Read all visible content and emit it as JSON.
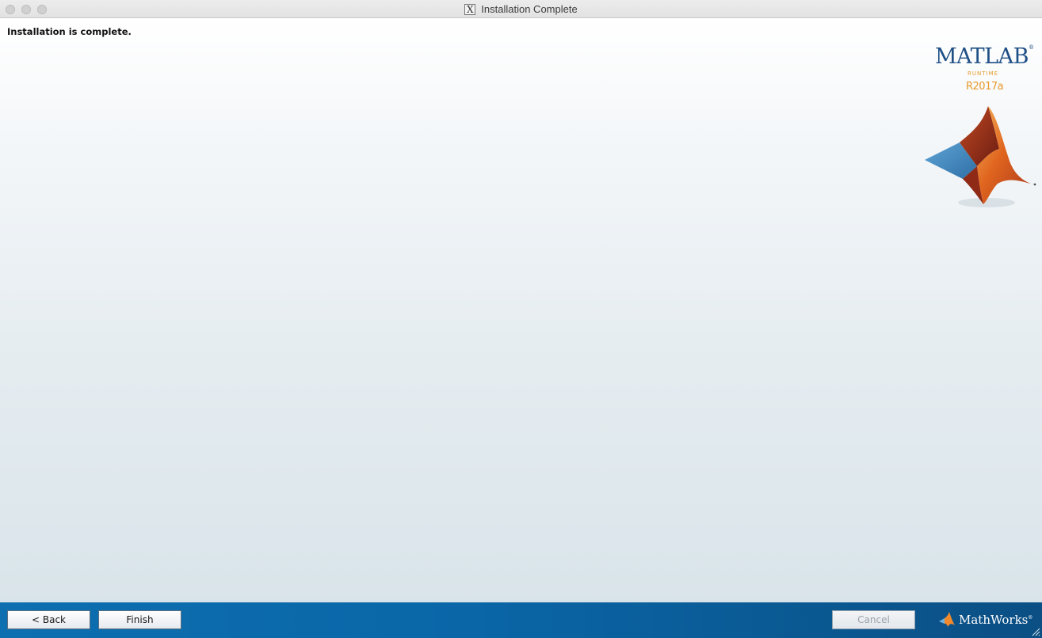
{
  "window": {
    "title": "Installation Complete",
    "title_icon": "X"
  },
  "content": {
    "message": "Installation is complete."
  },
  "logo": {
    "product": "MATLAB",
    "registered": "®",
    "subtitle": "RUNTIME",
    "release": "R2017a"
  },
  "footer": {
    "back_label": "< Back",
    "finish_label": "Finish",
    "cancel_label": "Cancel",
    "cancel_enabled": false,
    "brand": "MathWorks",
    "brand_mark": "®"
  },
  "colors": {
    "footer_blue": "#0b6aab",
    "matlab_blue": "#1f4f86",
    "runtime_orange": "#e8992a"
  },
  "icons": [
    "close-dot-icon",
    "minimize-dot-icon",
    "zoom-dot-icon",
    "x11-icon",
    "matlab-membrane-icon",
    "mathworks-logo-icon",
    "resize-grip-icon"
  ]
}
